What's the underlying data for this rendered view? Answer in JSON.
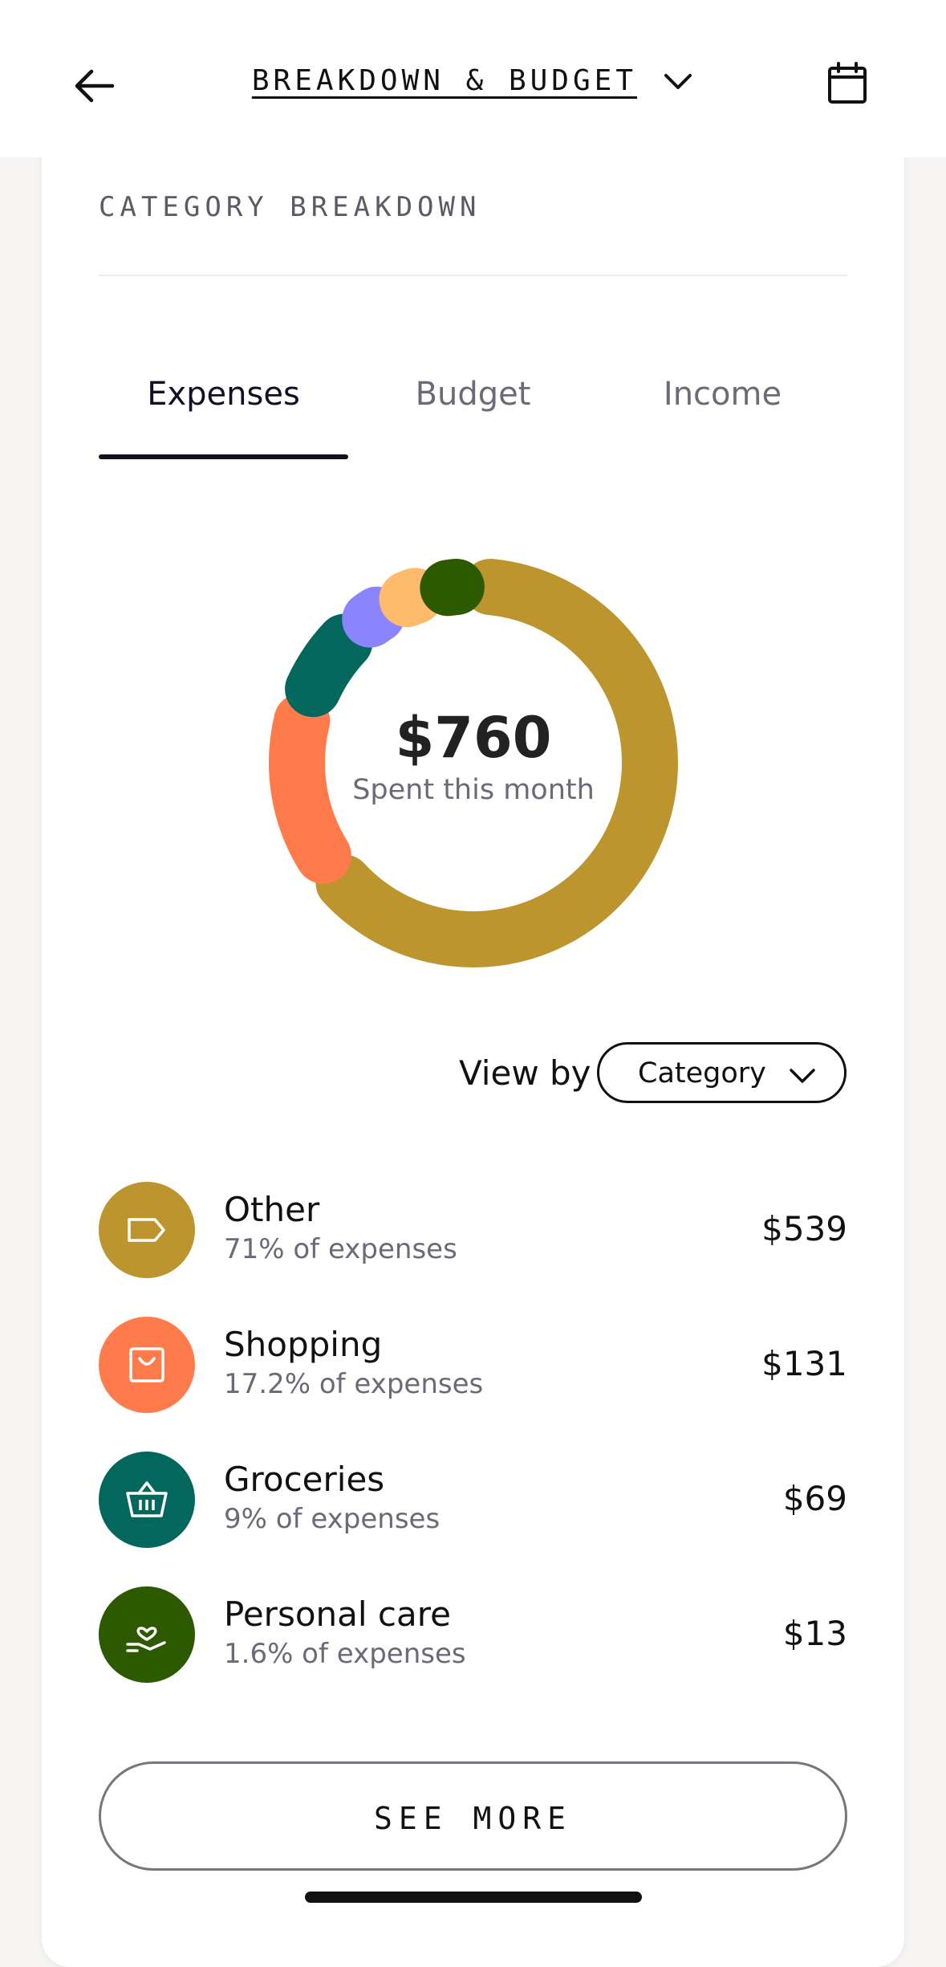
{
  "header": {
    "title": "BREAKDOWN & BUDGET",
    "back_icon": "arrow-left-icon",
    "calendar_icon": "calendar-icon",
    "dropdown_icon": "chevron-down-icon"
  },
  "section": {
    "title": "CATEGORY BREAKDOWN"
  },
  "tabs": [
    {
      "label": "Expenses",
      "active": true
    },
    {
      "label": "Budget",
      "active": false
    },
    {
      "label": "Income",
      "active": false
    }
  ],
  "summary": {
    "amount": "$760",
    "caption": "Spent this month"
  },
  "view_by": {
    "label": "View by",
    "value": "Category"
  },
  "categories": [
    {
      "name": "Other",
      "pct_label": "71% of expenses",
      "amount": "$539",
      "color": "#bc952f",
      "icon": "tag-icon"
    },
    {
      "name": "Shopping",
      "pct_label": "17.2% of expenses",
      "amount": "$131",
      "color": "#ff7b4b",
      "icon": "shopping-bag-icon"
    },
    {
      "name": "Groceries",
      "pct_label": "9% of expenses",
      "amount": "$69",
      "color": "#03675e",
      "icon": "basket-icon"
    },
    {
      "name": "Personal care",
      "pct_label": "1.6% of expenses",
      "amount": "$13",
      "color": "#2d5a00",
      "icon": "hand-heart-icon"
    }
  ],
  "chart_data": {
    "type": "pie",
    "variant": "donut",
    "segments": [
      {
        "value": 71.0,
        "color": "#bc952f"
      },
      {
        "value": 17.2,
        "color": "#ff7b4b"
      },
      {
        "value": 9.0,
        "color": "#03675e"
      },
      {
        "value": 4.2,
        "color": "#8b84ff"
      },
      {
        "value": 4.2,
        "color": "#fdbb6b"
      },
      {
        "value": 4.2,
        "color": "#2d5a00"
      }
    ]
  },
  "see_more": {
    "label": "SEE MORE"
  }
}
